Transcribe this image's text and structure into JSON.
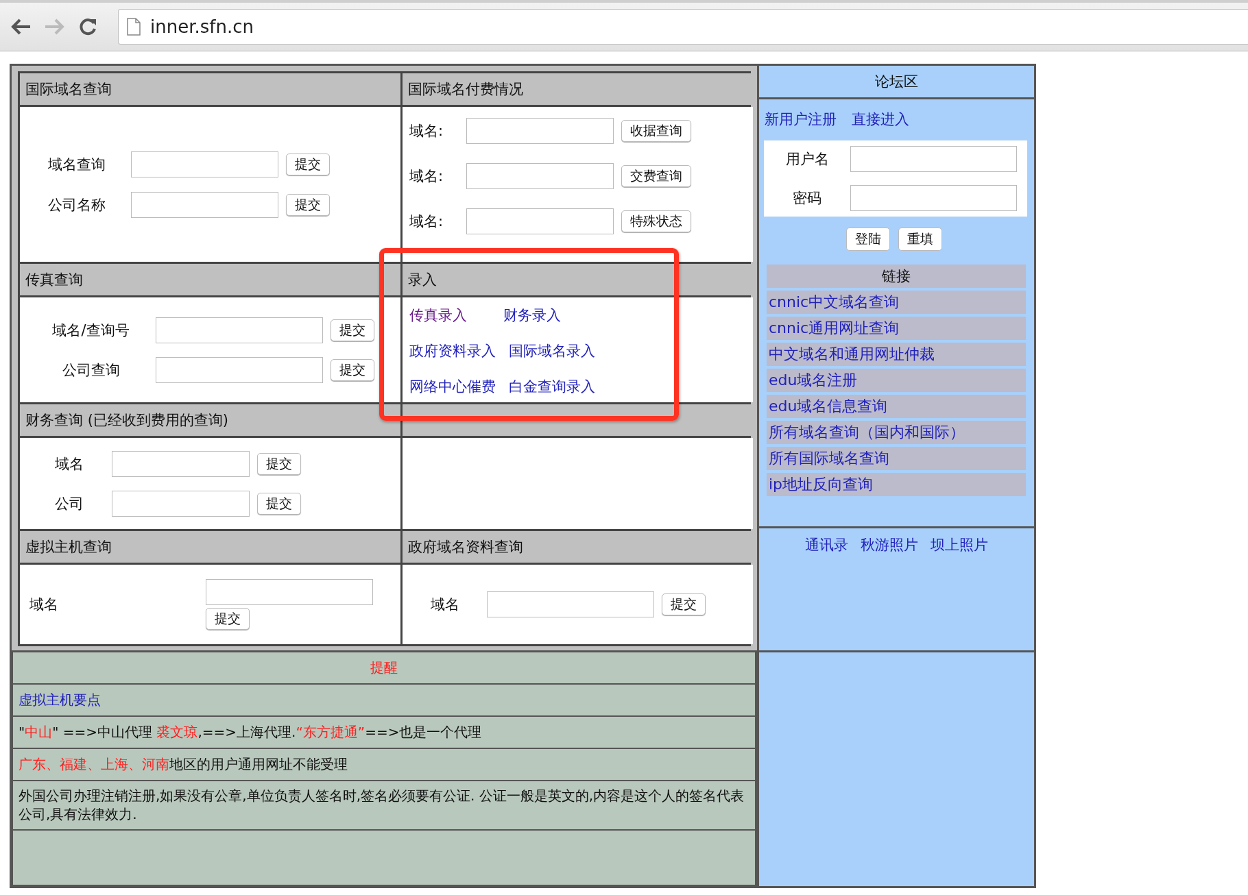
{
  "browser": {
    "url": "inner.sfn.cn"
  },
  "sections": [
    {
      "kind": "form",
      "title": "国际域名查询",
      "rows": [
        {
          "label": "域名查询",
          "button": "提交"
        },
        {
          "label": "公司名称",
          "button": "提交"
        }
      ]
    },
    {
      "kind": "form",
      "title": "国际域名付费情况",
      "rows": [
        {
          "label": "域名:",
          "button": "收据查询"
        },
        {
          "label": "域名:",
          "button": "交费查询"
        },
        {
          "label": "域名:",
          "button": "特殊状态"
        }
      ]
    },
    {
      "kind": "form",
      "title": "传真查询",
      "rows": [
        {
          "label": "域名/查询号",
          "button": "提交"
        },
        {
          "label": "公司查询",
          "button": "提交"
        }
      ]
    },
    {
      "kind": "links",
      "title": "录入",
      "rows": [
        [
          {
            "label": "传真录入",
            "visited": true
          },
          {
            "label": "财务录入",
            "visited": false
          }
        ],
        [
          {
            "label": "政府资料录入",
            "visited": false
          },
          {
            "label": "国际域名录入",
            "visited": false
          }
        ],
        [
          {
            "label": "网络中心催费",
            "visited": false
          },
          {
            "label": "白金查询录入",
            "visited": false
          }
        ]
      ]
    },
    {
      "kind": "form",
      "title": "财务查询 (已经收到费用的查询)",
      "rows": [
        {
          "label": "域名",
          "button": "提交"
        },
        {
          "label": "公司",
          "button": "提交"
        }
      ]
    },
    {
      "kind": "blank"
    },
    {
      "kind": "stacked",
      "title": "虚拟主机查询",
      "rows": [
        {
          "label": "域名",
          "button": "提交"
        }
      ]
    },
    {
      "kind": "form",
      "title": "政府域名资料查询",
      "rows": [
        {
          "label": "域名",
          "button": "提交"
        }
      ]
    }
  ],
  "forum": {
    "title": "论坛区",
    "top_links": [
      "新用户注册",
      "直接进入"
    ],
    "login": [
      {
        "label": "用户名"
      },
      {
        "label": "密码"
      }
    ],
    "buttons": [
      "登陆",
      "重填"
    ],
    "links_title": "链接",
    "links": [
      "cnnic中文域名查询",
      "cnnic通用网址查询",
      "中文域名和通用网址仲裁",
      "edu域名注册",
      "edu域名信息查询",
      "所有域名查询（国内和国际）",
      "所有国际域名查询",
      "ip地址反向查询"
    ],
    "footer_links": [
      "通讯录",
      "秋游照片",
      "坝上照片"
    ]
  },
  "notes": {
    "title": "提醒",
    "items": [
      {
        "kind": "link",
        "text": "虚拟主机要点"
      },
      {
        "kind": "text",
        "parts": [
          {
            "text": "\"",
            "highlight": false
          },
          {
            "text": "中山",
            "highlight": true
          },
          {
            "text": "\" ==>中山代理 ",
            "highlight": false
          },
          {
            "text": "裘文琼",
            "highlight": true
          },
          {
            "text": ",==>上海代理.",
            "highlight": false
          },
          {
            "text": "“东方捷通”",
            "highlight": true
          },
          {
            "text": "==>也是一个代理",
            "highlight": false
          }
        ]
      },
      {
        "kind": "text",
        "parts": [
          {
            "text": "广东、福建、上海、河南",
            "highlight": true
          },
          {
            "text": "地区的用户通用网址不能受理",
            "highlight": false
          }
        ]
      },
      {
        "kind": "text",
        "parts": [
          {
            "text": "外国公司办理注销注册,如果没有公章,单位负责人签名时,签名必须要有公证. 公证一般是英文的,内容是这个人的签名代表公司,具有法律效力.",
            "highlight": false
          }
        ]
      },
      {
        "kind": "empty"
      }
    ]
  }
}
